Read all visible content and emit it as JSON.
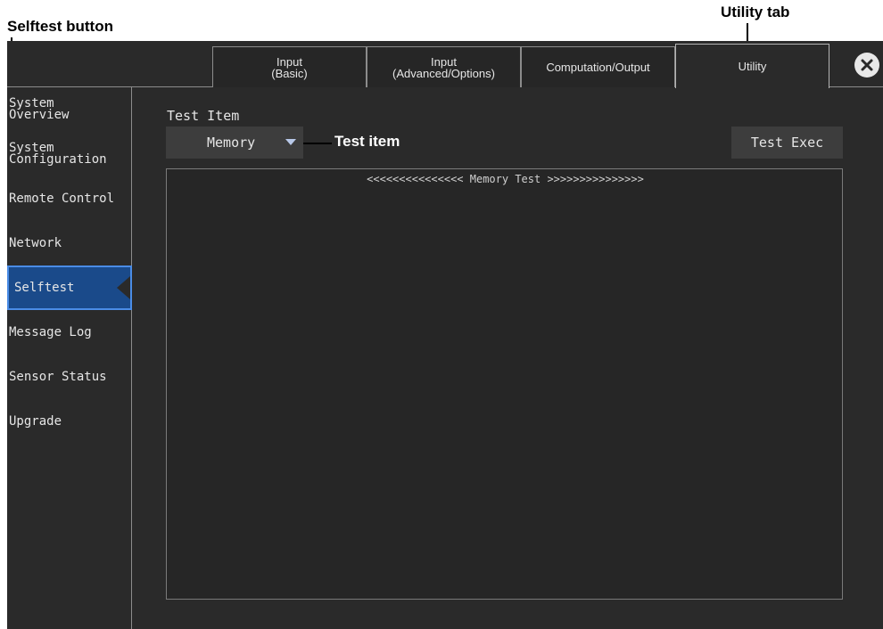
{
  "annotations": {
    "selftest_button": "Selftest button",
    "utility_tab": "Utility tab",
    "test_item": "Test item"
  },
  "tabs": [
    {
      "label": "Input\n(Basic)",
      "active": false
    },
    {
      "label": "Input\n(Advanced/Options)",
      "active": false
    },
    {
      "label": "Computation/Output",
      "active": false
    },
    {
      "label": "Utility",
      "active": true
    }
  ],
  "close_icon": "close-icon",
  "sidebar": {
    "items": [
      {
        "label": "System\nOverview",
        "active": false
      },
      {
        "label": "System\nConfiguration",
        "active": false
      },
      {
        "label": "Remote Control",
        "active": false
      },
      {
        "label": "Network",
        "active": false
      },
      {
        "label": "Selftest",
        "active": true
      },
      {
        "label": "Message Log",
        "active": false
      },
      {
        "label": "Sensor Status",
        "active": false
      },
      {
        "label": "Upgrade",
        "active": false
      }
    ]
  },
  "main": {
    "section_label": "Test Item",
    "test_item_value": "Memory",
    "exec_button": "Test Exec",
    "result_title": "<<<<<<<<<<<<<<< Memory Test >>>>>>>>>>>>>>>"
  },
  "colors": {
    "screen_bg": "#2a2a2a",
    "active_accent": "#1a4a8a",
    "active_border": "#4a8ce6"
  }
}
